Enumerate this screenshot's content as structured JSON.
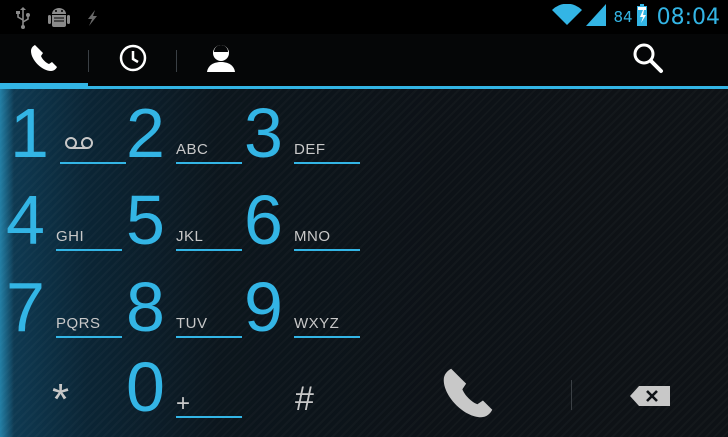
{
  "status_bar": {
    "battery_percent": "84",
    "time": "08:04",
    "icons": [
      "usb-icon",
      "android-debug-icon",
      "charging-bolt-icon",
      "wifi-icon",
      "signal-icon",
      "battery-icon"
    ]
  },
  "tabs": [
    {
      "name": "phone",
      "icon": "phone-icon",
      "selected": true
    },
    {
      "name": "recent",
      "icon": "clock-icon",
      "selected": false
    },
    {
      "name": "contacts",
      "icon": "contact-icon",
      "selected": false
    }
  ],
  "search_icon": "search-icon",
  "colors": {
    "accent": "#33b5e5",
    "background": "#0d1013",
    "text_secondary": "#c8c8c8"
  },
  "keys": [
    {
      "digit": "1",
      "letters": "",
      "sub_icon": "voicemail-icon"
    },
    {
      "digit": "2",
      "letters": "ABC"
    },
    {
      "digit": "3",
      "letters": "DEF"
    },
    {
      "digit": "4",
      "letters": "GHI"
    },
    {
      "digit": "5",
      "letters": "JKL"
    },
    {
      "digit": "6",
      "letters": "MNO"
    },
    {
      "digit": "7",
      "letters": "PQRS"
    },
    {
      "digit": "8",
      "letters": "TUV"
    },
    {
      "digit": "9",
      "letters": "WXYZ"
    },
    {
      "digit": "*",
      "letters": ""
    },
    {
      "digit": "0",
      "letters": "+"
    },
    {
      "digit": "#",
      "letters": ""
    }
  ],
  "actions": {
    "call_icon": "phone-call-icon",
    "delete_icon": "backspace-icon"
  }
}
